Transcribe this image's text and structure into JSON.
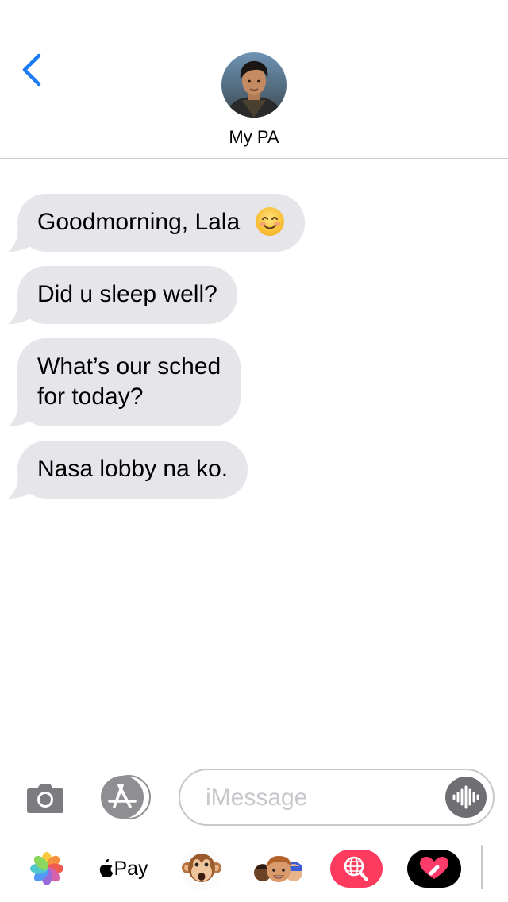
{
  "header": {
    "back_icon": "chevron-left-icon",
    "contact_name": "My PA",
    "avatar_icon": "contact-avatar",
    "accent_color": "#1a7cf6"
  },
  "messages": [
    {
      "text": "Goodmorning, Lala",
      "emoji": "smiling-face-emoji"
    },
    {
      "text": "Did u sleep well?"
    },
    {
      "text_line1": "What’s our sched",
      "text_line2": "for today?"
    },
    {
      "text": "Nasa lobby na ko."
    }
  ],
  "bubble_color": "#e5e5ea",
  "input_bar": {
    "camera_icon": "camera-icon",
    "apps_icon": "app-store-icon",
    "placeholder": "iMessage",
    "value": "",
    "audio_icon": "audio-waveform-icon"
  },
  "app_drawer": {
    "items": [
      {
        "name": "photos-app-icon"
      },
      {
        "name": "apple-pay-icon",
        "label": "Pay"
      },
      {
        "name": "animoji-monkey-icon"
      },
      {
        "name": "memoji-stickers-icon"
      },
      {
        "name": "web-search-icon",
        "color": "#fd3b5e"
      },
      {
        "name": "digital-touch-icon",
        "color": "#000000"
      }
    ]
  }
}
